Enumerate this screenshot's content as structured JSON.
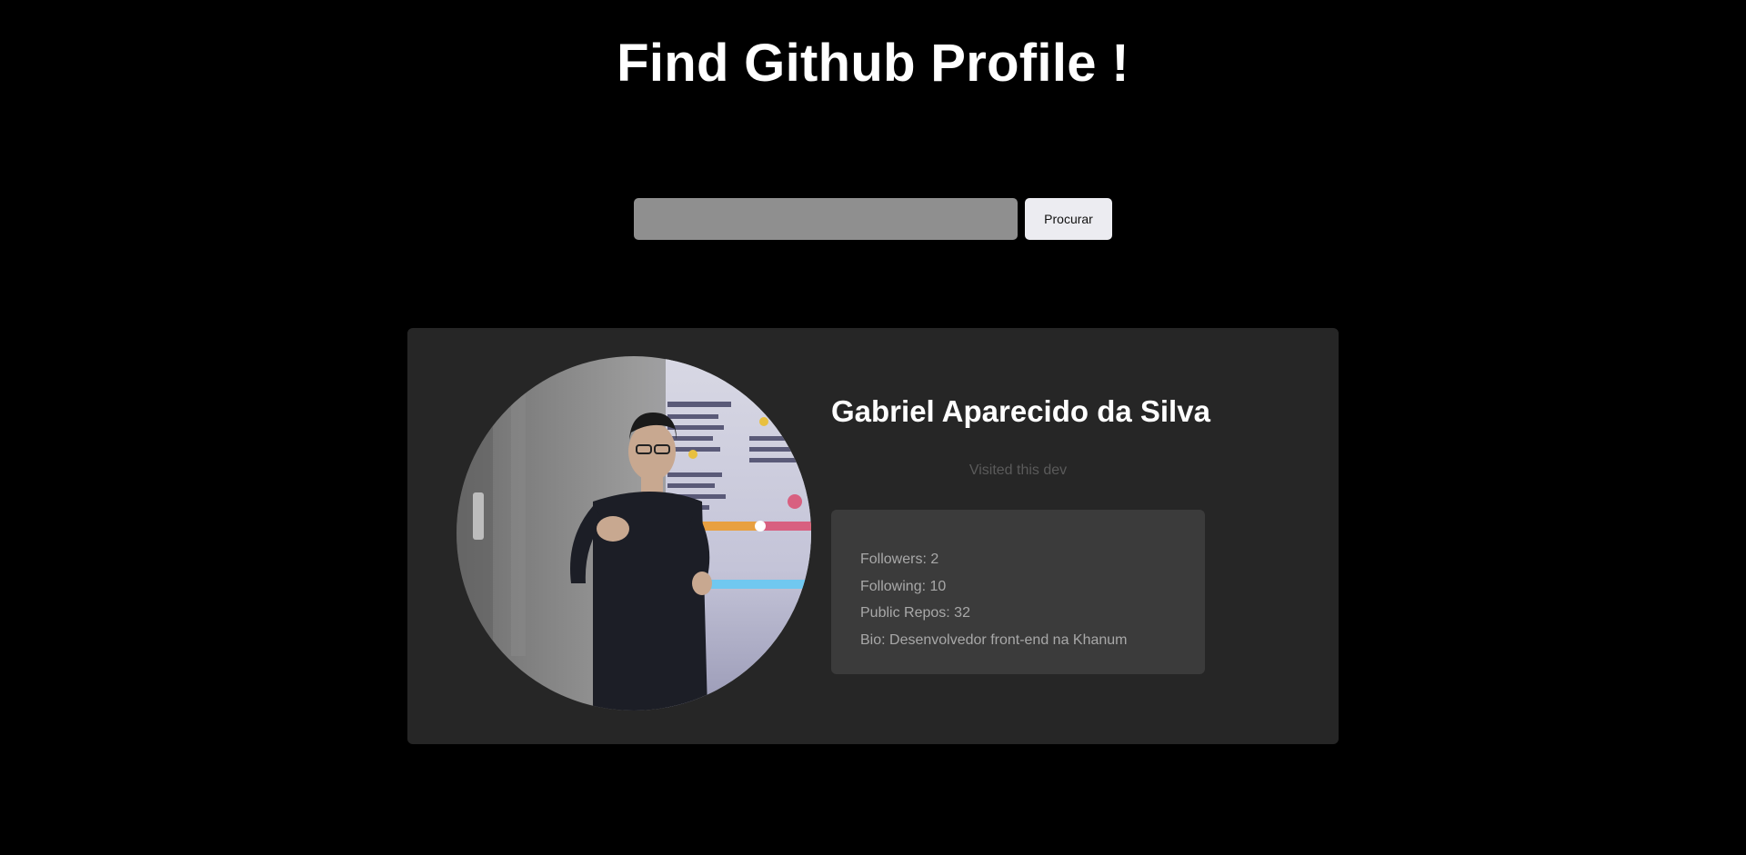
{
  "header": {
    "title": "Find Github Profile !"
  },
  "search": {
    "value": "",
    "placeholder": "",
    "button_label": "Procurar"
  },
  "profile": {
    "name": "Gabriel Aparecido da Silva",
    "visited_text": "Visited this dev",
    "avatar_icon": "user-photo",
    "stats": {
      "followers": "Followers: 2",
      "following": "Following: 10",
      "public_repos": "Public Repos: 32",
      "bio": "Bio: Desenvolvedor front-end na Khanum"
    }
  },
  "colors": {
    "background": "#000000",
    "card": "#262626",
    "stats_box": "#3b3b3b",
    "input": "#8f8f8f",
    "button": "#ececf1"
  }
}
